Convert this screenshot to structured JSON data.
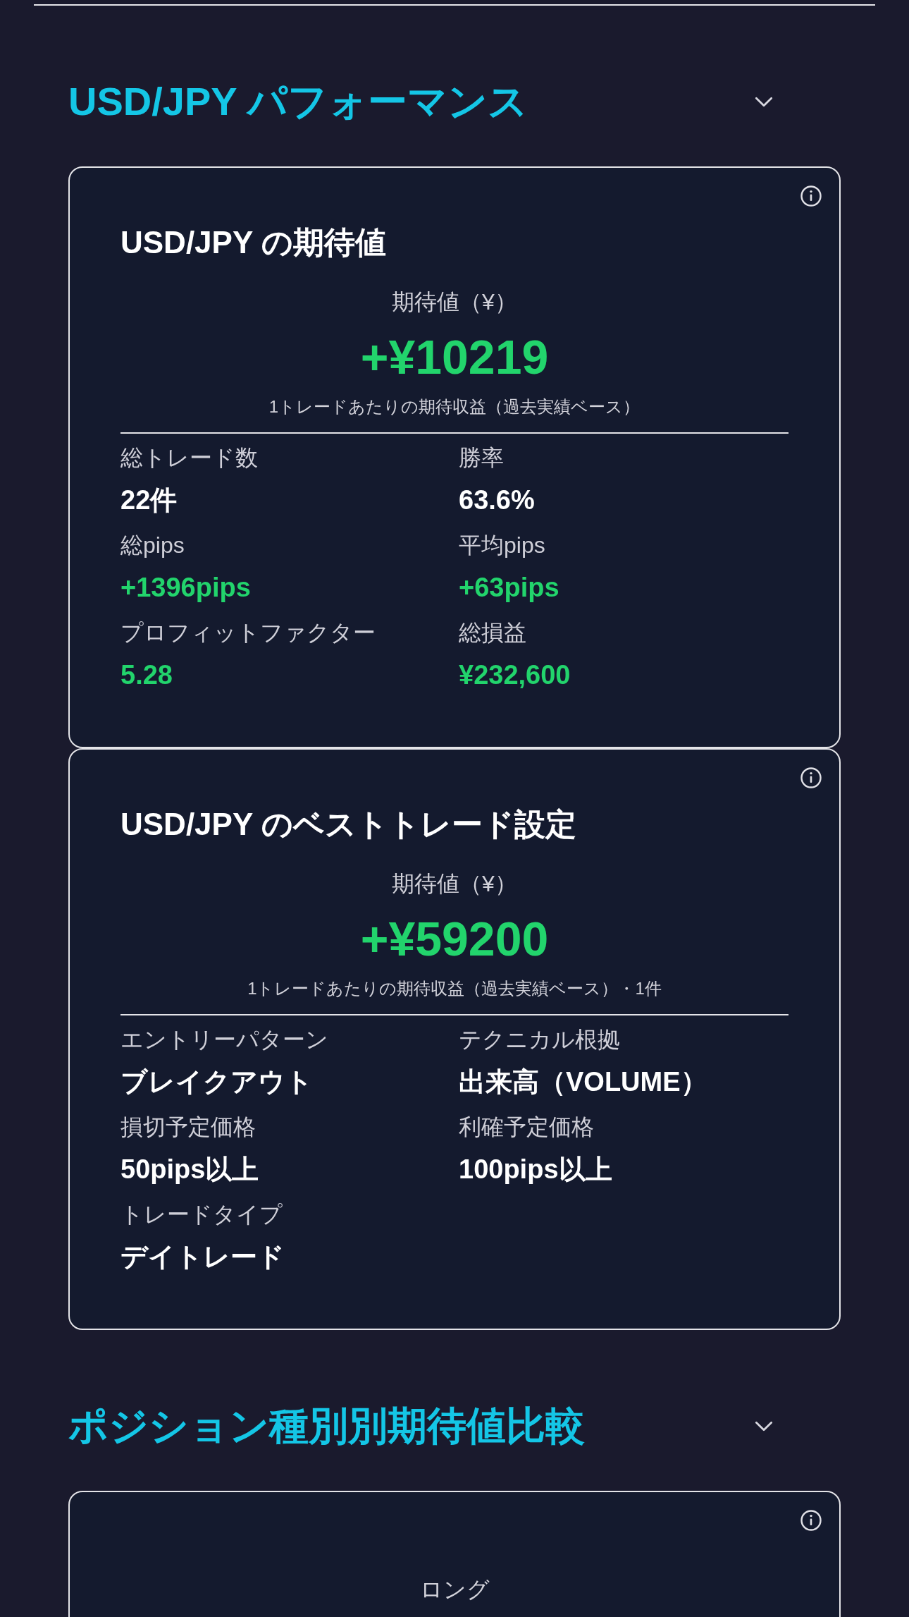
{
  "sections": [
    {
      "title": "USD/JPY パフォーマンス",
      "expanded": false,
      "cards": [
        {
          "title": "USD/JPY の期待値",
          "metric_label": "期待値（¥）",
          "metric_value": "+¥10219",
          "metric_note": "1トレードあたりの期待収益（過去実績ベース）",
          "stats": [
            {
              "label": "総トレード数",
              "value": "22件",
              "kind": "plain"
            },
            {
              "label": "勝率",
              "value": "63.6%",
              "kind": "plain"
            },
            {
              "label": "総pips",
              "value": "+1396pips",
              "kind": "gain"
            },
            {
              "label": "平均pips",
              "value": "+63pips",
              "kind": "gain"
            },
            {
              "label": "プロフィットファクター",
              "value": "5.28",
              "kind": "gain"
            },
            {
              "label": "総損益",
              "value": "¥232,600",
              "kind": "gain"
            }
          ]
        },
        {
          "title": "USD/JPY のベストトレード設定",
          "metric_label": "期待値（¥）",
          "metric_value": "+¥59200",
          "metric_note": "1トレードあたりの期待収益（過去実績ベース）・1件",
          "stats": [
            {
              "label": "エントリーパターン",
              "value": "ブレイクアウト",
              "kind": "plain"
            },
            {
              "label": "テクニカル根拠",
              "value": "出来高（VOLUME）",
              "kind": "plain"
            },
            {
              "label": "損切予定価格",
              "value": "50pips以上",
              "kind": "plain"
            },
            {
              "label": "利確予定価格",
              "value": "100pips以上",
              "kind": "plain"
            },
            {
              "label": "トレードタイプ",
              "value": "デイトレード",
              "kind": "plain"
            }
          ]
        }
      ]
    },
    {
      "title": "ポジション種別別期待値比較",
      "expanded": false,
      "cards": [
        {
          "metric_label": "ロング"
        }
      ]
    }
  ]
}
